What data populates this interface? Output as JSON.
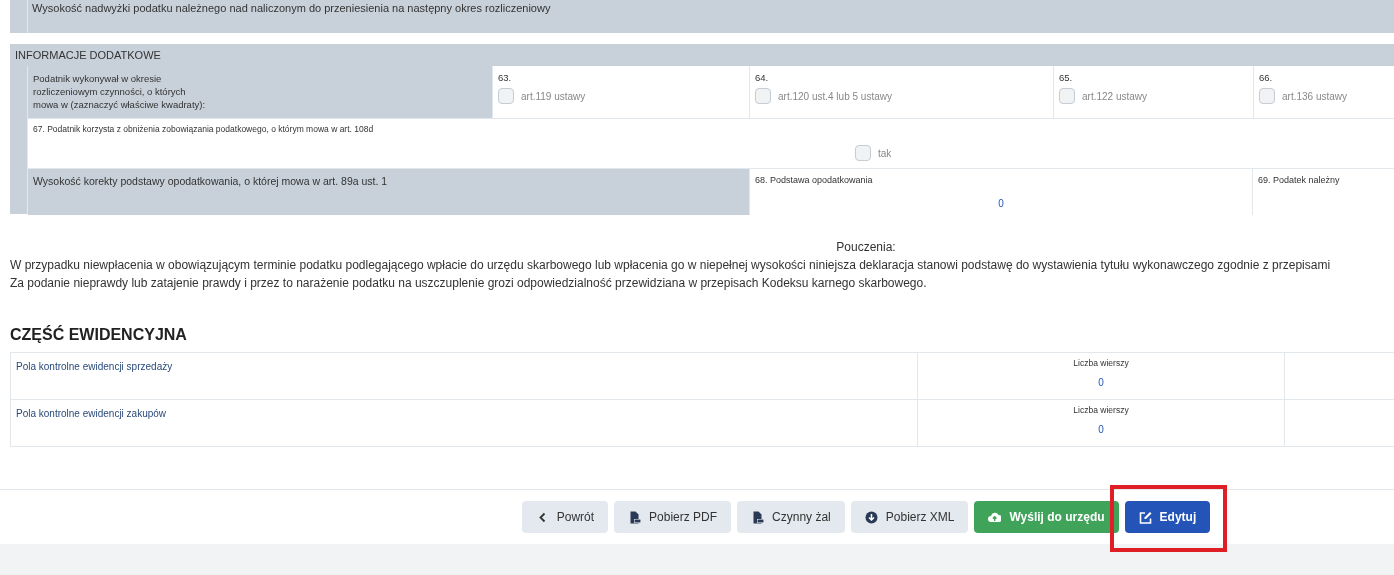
{
  "top_row": {
    "label": "Wysokość nadwyżki podatku należnego nad naliczonym do przeniesienia na następny okres rozliczeniowy"
  },
  "additional_info": {
    "title": "INFORMACJE DODATKOWE",
    "activities": {
      "label": "Podatnik wykonywał w okresie\nrozliczeniowym czynności, o których\nmowa w (zaznaczyć właściwe kwadraty):",
      "options": [
        {
          "number": "63.",
          "label": "art.119 ustawy",
          "checked": false
        },
        {
          "number": "64.",
          "label": "art.120 ust.4 lub 5 ustawy",
          "checked": false
        },
        {
          "number": "65.",
          "label": "art.122 ustawy",
          "checked": false
        },
        {
          "number": "66.",
          "label": "art.136 ustawy",
          "checked": false
        }
      ]
    },
    "reduction": {
      "label": "67. Podatnik korzysta z obniżenia zobowiązania podatkowego, o którym mowa w art. 108d",
      "option": {
        "label": "tak",
        "checked": false
      }
    },
    "correction": {
      "label": "Wysokość korekty podstawy opodatkowania, o której mowa w art. 89a ust. 1",
      "fields": [
        {
          "label": "68. Podstawa opodatkowania",
          "value": "0"
        },
        {
          "label": "69. Podatek należny"
        }
      ]
    }
  },
  "instructions": {
    "title": "Pouczenia:",
    "lines": [
      "W przypadku niewpłacenia w obowiązującym terminie podatku podlegającego wpłacie do urzędu skarbowego lub wpłacenia go w niepełnej wysokości niniejsza deklaracja stanowi podstawę do wystawienia tytułu wykonawczego zgodnie z przepisami",
      "Za podanie nieprawdy lub zatajenie prawdy i przez to narażenie podatku na uszczuplenie grozi odpowiedzialność przewidziana w przepisach Kodeksu karnego skarbowego."
    ]
  },
  "records": {
    "title": "CZĘŚĆ EWIDENCYJNA",
    "rows": [
      {
        "label": "Pola kontrolne ewidencji sprzedaży",
        "count_label": "Liczba wierszy",
        "count": "0"
      },
      {
        "label": "Pola kontrolne ewidencji zakupów",
        "count_label": "Liczba wierszy",
        "count": "0"
      }
    ]
  },
  "actions": [
    {
      "label": "Powrót",
      "kind": "back",
      "highlighted": false
    },
    {
      "label": "Pobierz PDF",
      "kind": "pdf",
      "highlighted": false
    },
    {
      "label": "Czynny żal",
      "kind": "pdf",
      "highlighted": false
    },
    {
      "label": "Pobierz XML",
      "kind": "download",
      "highlighted": false
    },
    {
      "label": "Wyślij do urzędu",
      "kind": "send",
      "highlighted": false
    },
    {
      "label": "Edytuj",
      "kind": "edit",
      "highlighted": true
    }
  ]
}
